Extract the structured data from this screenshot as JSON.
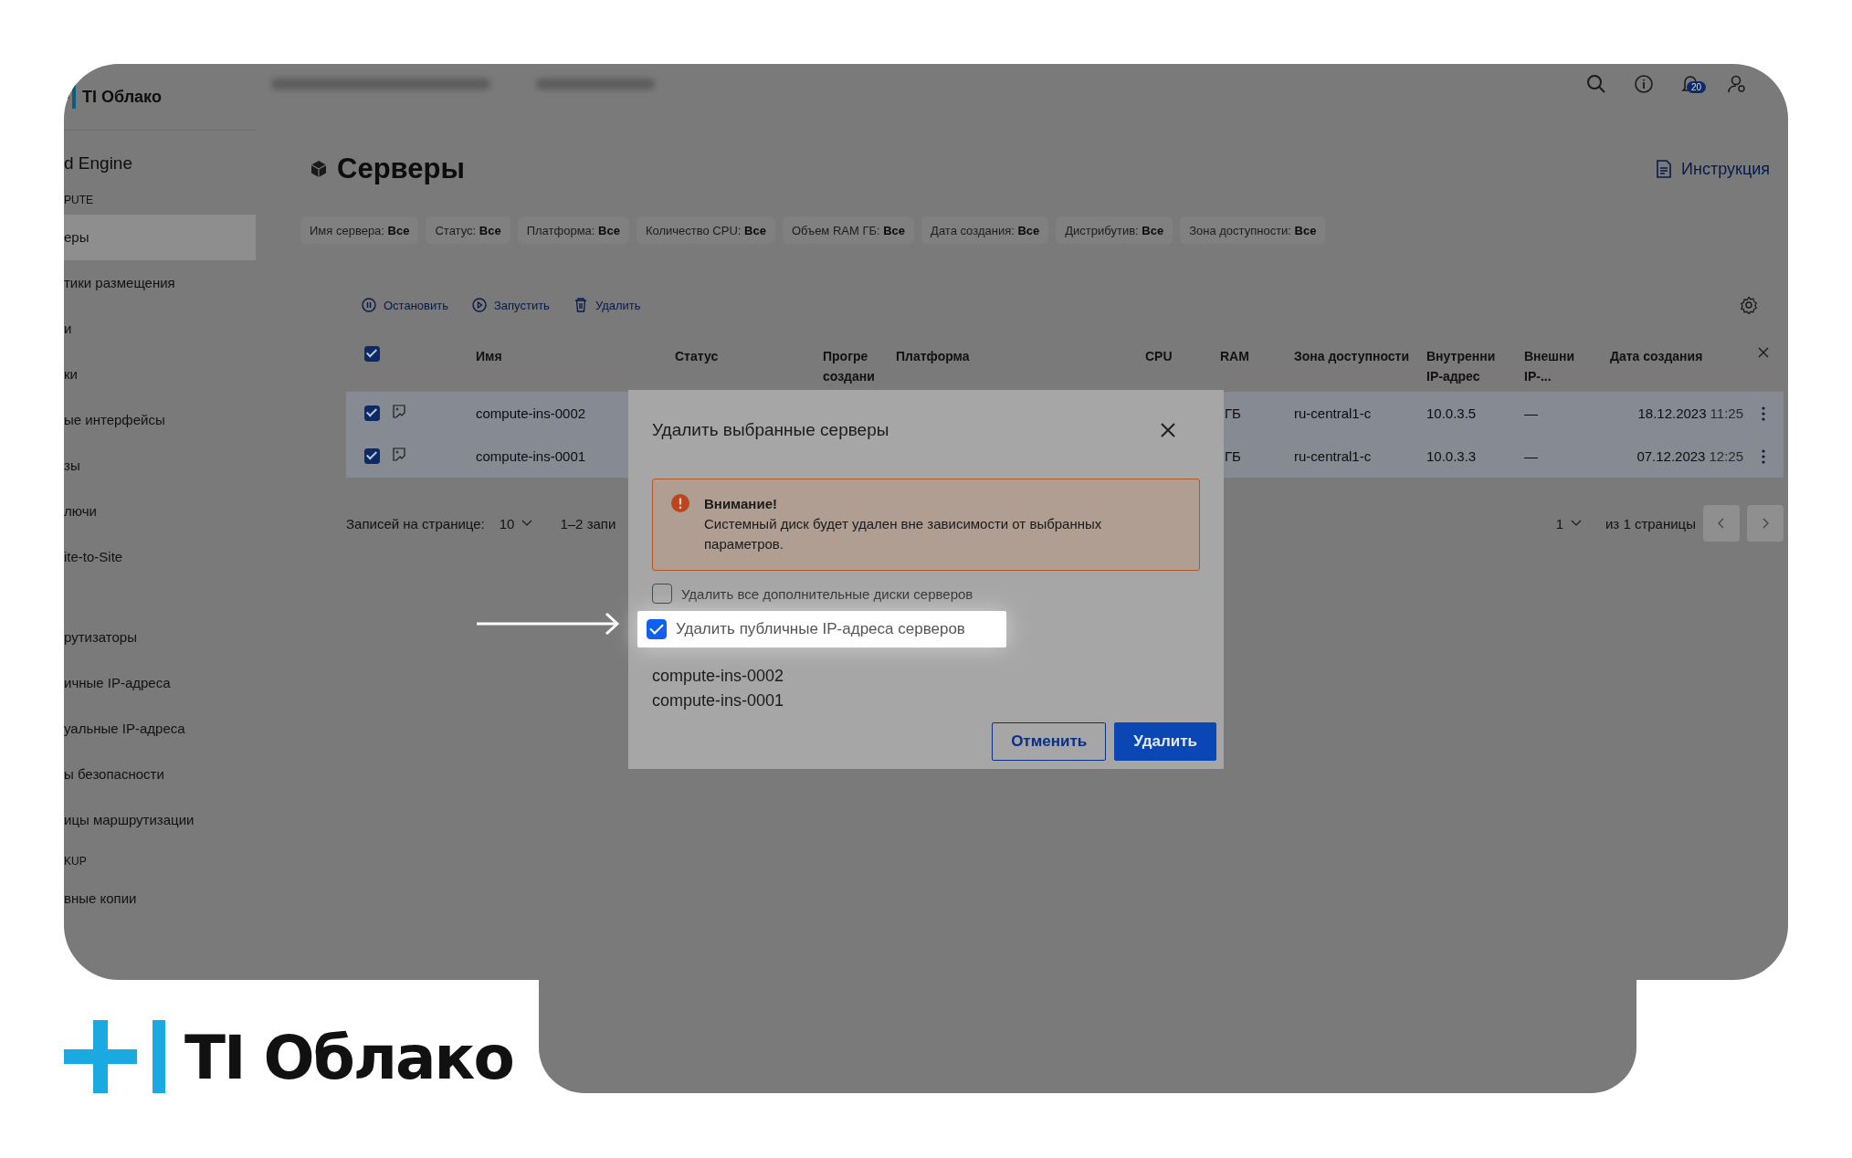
{
  "brand": {
    "logo_text": "TI Облако"
  },
  "topbar": {
    "notifications_badge": "20"
  },
  "sidebar": {
    "logo_text": "TI Облако",
    "items": [
      {
        "label": "d Engine",
        "kind": "product",
        "selected": false
      },
      {
        "label": "PUTE",
        "kind": "section",
        "selected": false
      },
      {
        "label": "еры",
        "kind": "item",
        "selected": true
      },
      {
        "label": "тики размещения",
        "kind": "item",
        "selected": false
      },
      {
        "label": "и",
        "kind": "item",
        "selected": false
      },
      {
        "label": "ки",
        "kind": "item",
        "selected": false
      },
      {
        "label": "ые интерфейсы",
        "kind": "item",
        "selected": false
      },
      {
        "label": "зы",
        "kind": "item",
        "selected": false
      },
      {
        "label": "лючи",
        "kind": "item",
        "selected": false
      },
      {
        "label": "ite-to-Site",
        "kind": "item",
        "selected": false
      },
      {
        "label": "рутизаторы",
        "kind": "item",
        "selected": false
      },
      {
        "label": "ичные IP-адреса",
        "kind": "item",
        "selected": false
      },
      {
        "label": "уальные IP-адреса",
        "kind": "item",
        "selected": false
      },
      {
        "label": "ы безопасности",
        "kind": "item",
        "selected": false
      },
      {
        "label": "ицы маршрутизации",
        "kind": "item",
        "selected": false
      },
      {
        "label": "KUP",
        "kind": "section",
        "selected": false
      },
      {
        "label": "вные копии",
        "kind": "item",
        "selected": false
      }
    ]
  },
  "page": {
    "title": "Серверы",
    "help_link": "Инструкция"
  },
  "filters": [
    {
      "label": "Имя сервера:",
      "value": "Все"
    },
    {
      "label": "Статус:",
      "value": "Все"
    },
    {
      "label": "Платформа:",
      "value": "Все"
    },
    {
      "label": "Количество CPU:",
      "value": "Все"
    },
    {
      "label": "Объем RAM ГБ:",
      "value": "Все"
    },
    {
      "label": "Дата создания:",
      "value": "Все"
    },
    {
      "label": "Дистрибутив:",
      "value": "Все"
    },
    {
      "label": "Зона доступности:",
      "value": "Все"
    }
  ],
  "toolbar": [
    {
      "label": "Остановить",
      "kind": "stop"
    },
    {
      "label": "Запустить",
      "kind": "start"
    },
    {
      "label": "Удалить",
      "kind": "delete"
    }
  ],
  "table": {
    "all_checked": true,
    "columns": [
      "Имя",
      "Статус",
      "Прогре создани",
      "Платформа",
      "CPU",
      "RAM",
      "Зона доступности",
      "Внутренни IP-адрес",
      "Внешни IP-...",
      "Дата создания"
    ],
    "rows": [
      {
        "checked": true,
        "name": "compute-ins-0002",
        "ram": "ГБ",
        "zone": "ru-central1-c",
        "internal_ip": "10.0.3.5",
        "external_ip": "—",
        "date": "18.12.2023",
        "time": "11:25"
      },
      {
        "checked": true,
        "name": "compute-ins-0001",
        "ram": "ГБ",
        "zone": "ru-central1-c",
        "internal_ip": "10.0.3.3",
        "external_ip": "—",
        "date": "07.12.2023",
        "time": "12:25"
      }
    ]
  },
  "pagination": {
    "per_page_label": "Записей на странице:",
    "per_page": "10",
    "range": "1–2 запи",
    "page": "1",
    "pages_label": "из 1 страницы"
  },
  "dialog": {
    "title": "Удалить выбранные серверы",
    "alert": {
      "title": "Внимание!",
      "text": "Системный диск будет удален вне зависимости от выбранных параметров."
    },
    "options": [
      {
        "label": "Удалить все дополнительные диски серверов",
        "checked": false,
        "highlighted": false
      },
      {
        "label": "Удалить публичные IP-адреса серверов",
        "checked": true,
        "highlighted": true
      }
    ],
    "servers": [
      "compute-ins-0002",
      "compute-ins-0001"
    ],
    "buttons": [
      {
        "label": "Отменить",
        "kind": "secondary"
      },
      {
        "label": "Удалить",
        "kind": "primary"
      }
    ]
  }
}
